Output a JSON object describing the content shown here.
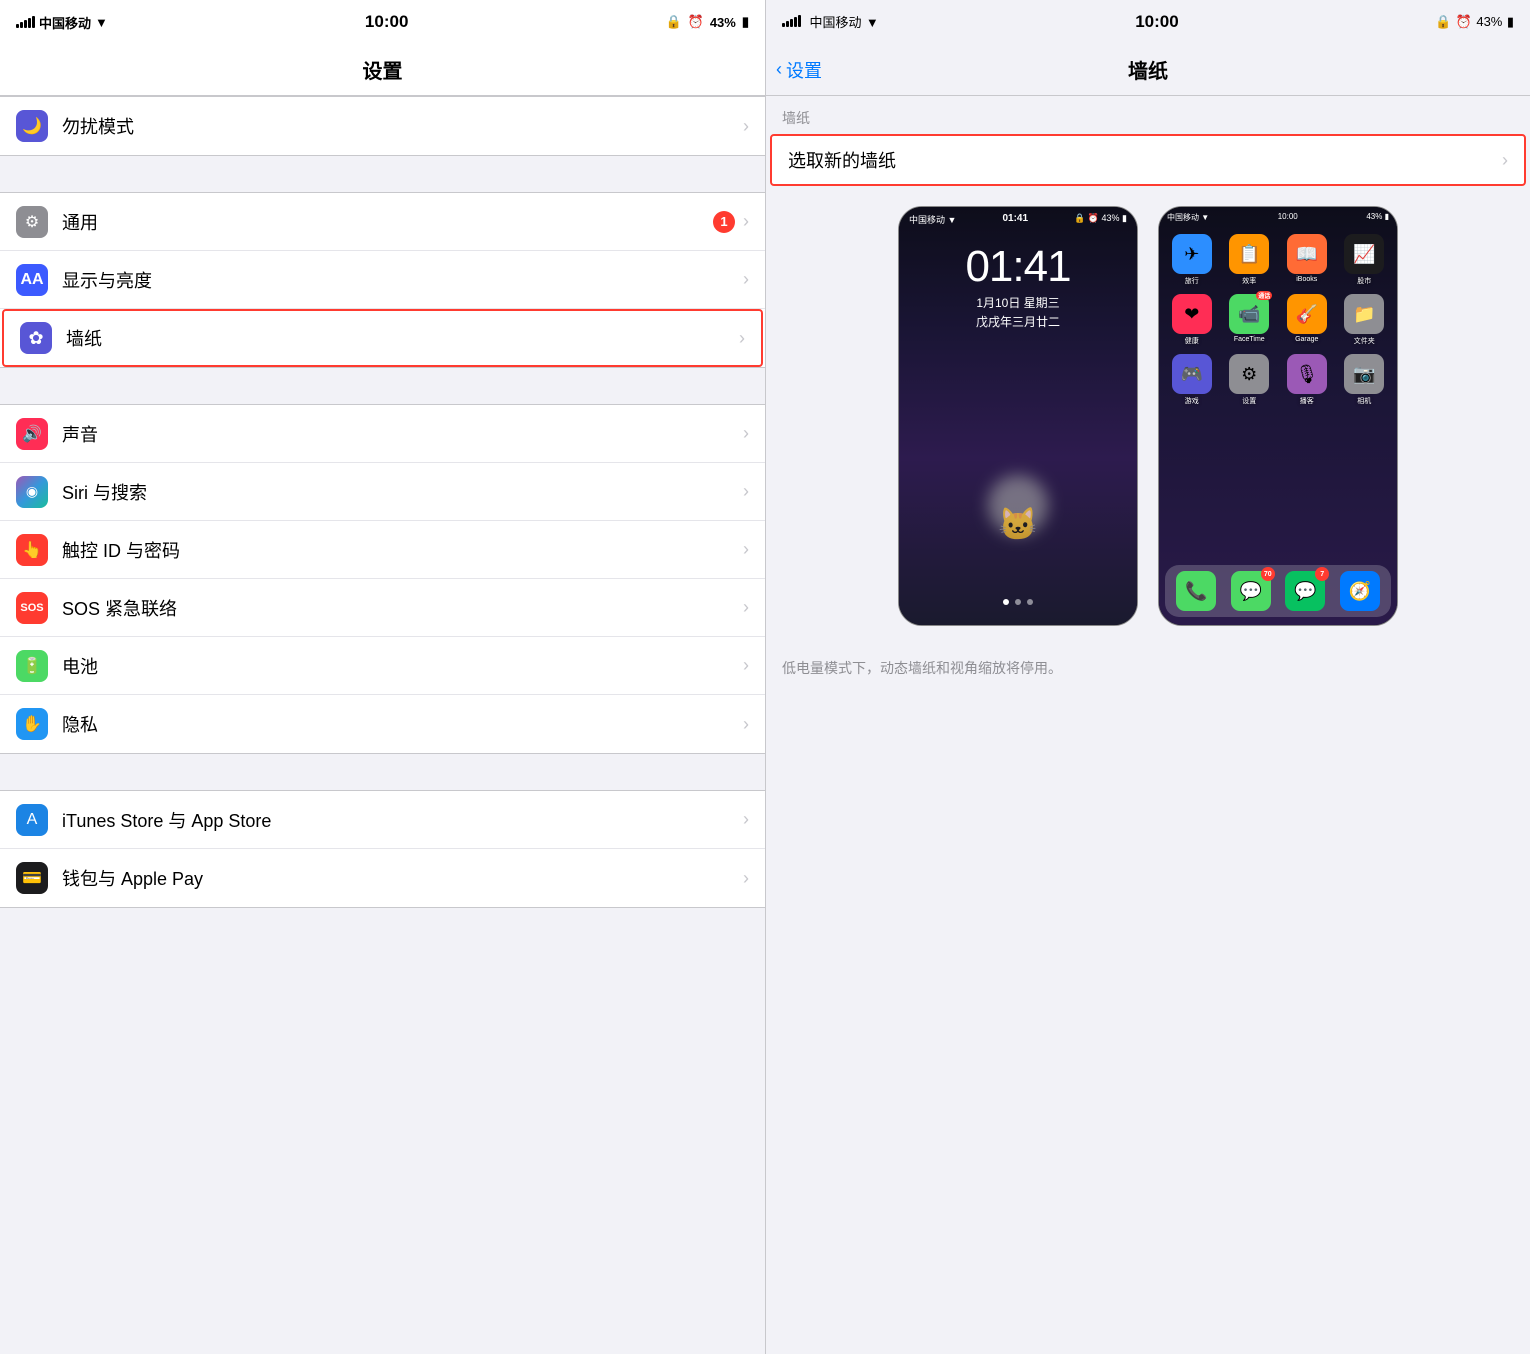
{
  "left": {
    "status": {
      "carrier": "中国移动",
      "wifi": "WiFi",
      "time": "10:00",
      "battery": "43%"
    },
    "title": "设置",
    "items": [
      {
        "id": "dnd",
        "label": "勿扰模式",
        "icon": "dnd",
        "badge": null,
        "highlighted": false
      },
      {
        "id": "general",
        "label": "通用",
        "icon": "general",
        "badge": "1",
        "highlighted": false
      },
      {
        "id": "display",
        "label": "显示与亮度",
        "icon": "display",
        "badge": null,
        "highlighted": false
      },
      {
        "id": "wallpaper",
        "label": "墙纸",
        "icon": "wallpaper",
        "badge": null,
        "highlighted": true
      },
      {
        "id": "sounds",
        "label": "声音",
        "icon": "sounds",
        "badge": null,
        "highlighted": false
      },
      {
        "id": "siri",
        "label": "Siri 与搜索",
        "icon": "siri",
        "badge": null,
        "highlighted": false
      },
      {
        "id": "touchid",
        "label": "触控 ID 与密码",
        "icon": "touchid",
        "badge": null,
        "highlighted": false
      },
      {
        "id": "sos",
        "label": "SOS 紧急联络",
        "icon": "sos",
        "badge": null,
        "highlighted": false
      },
      {
        "id": "battery",
        "label": "电池",
        "icon": "battery",
        "badge": null,
        "highlighted": false
      },
      {
        "id": "privacy",
        "label": "隐私",
        "icon": "privacy",
        "badge": null,
        "highlighted": false
      },
      {
        "id": "itunes",
        "label": "iTunes Store 与 App Store",
        "icon": "itunes",
        "badge": null,
        "highlighted": false
      },
      {
        "id": "wallet",
        "label": "钱包与 Apple Pay",
        "icon": "wallet",
        "badge": null,
        "highlighted": false
      }
    ]
  },
  "right": {
    "status": {
      "carrier": "中国移动",
      "wifi": "WiFi",
      "time": "10:00",
      "battery": "43%"
    },
    "back_label": "设置",
    "title": "墙纸",
    "section_label": "墙纸",
    "select_label": "选取新的墙纸",
    "lock_time": "01:41",
    "lock_date": "1月10日 星期三",
    "lock_subdate": "戊戌年三月廿二",
    "note": "低电量模式下，动态墙纸和视角缩放将停用。",
    "home_apps": [
      {
        "label": "旅行",
        "bg": "#2c8eff",
        "icon": "✈"
      },
      {
        "label": "效率",
        "bg": "#ff9500",
        "icon": "📋"
      },
      {
        "label": "iBooks",
        "bg": "#ff6b35",
        "icon": "📖"
      },
      {
        "label": "股市",
        "bg": "#1c1c1e",
        "icon": "📈"
      },
      {
        "label": "健康",
        "bg": "#ff2d55",
        "icon": "❤"
      },
      {
        "label": "FaceTime",
        "bg": "#4cd964",
        "icon": "📹"
      },
      {
        "label": "Garage",
        "bg": "#ff9500",
        "icon": "🎸"
      },
      {
        "label": "文件夹",
        "bg": "#8e8e93",
        "icon": "📁"
      },
      {
        "label": "游戏",
        "bg": "#5856d6",
        "icon": "🎮"
      },
      {
        "label": "设置",
        "bg": "#8e8e93",
        "icon": "⚙"
      },
      {
        "label": "播客",
        "bg": "#9b59b6",
        "icon": "🎙"
      },
      {
        "label": "相机",
        "bg": "#8e8e93",
        "icon": "📷"
      }
    ],
    "dock_apps": [
      {
        "label": "电话",
        "bg": "#4cd964",
        "icon": "📞",
        "badge": null
      },
      {
        "label": "短信",
        "bg": "#4cd964",
        "icon": "💬",
        "badge": "70"
      },
      {
        "label": "微信",
        "bg": "#07c160",
        "icon": "💬",
        "badge": "7"
      },
      {
        "label": "Safari",
        "bg": "#007aff",
        "icon": "🧭",
        "badge": null
      }
    ]
  },
  "icons": {
    "moon": "🌙",
    "gear": "⚙",
    "aa": "AA",
    "flower": "✿",
    "speaker": "🔊",
    "siri": "◉",
    "fingerprint": "👆",
    "sos": "SOS",
    "battery": "🔋",
    "hand": "✋",
    "appstore": "A",
    "wallet": "💳",
    "chevron": "›",
    "back_chevron": "‹"
  }
}
